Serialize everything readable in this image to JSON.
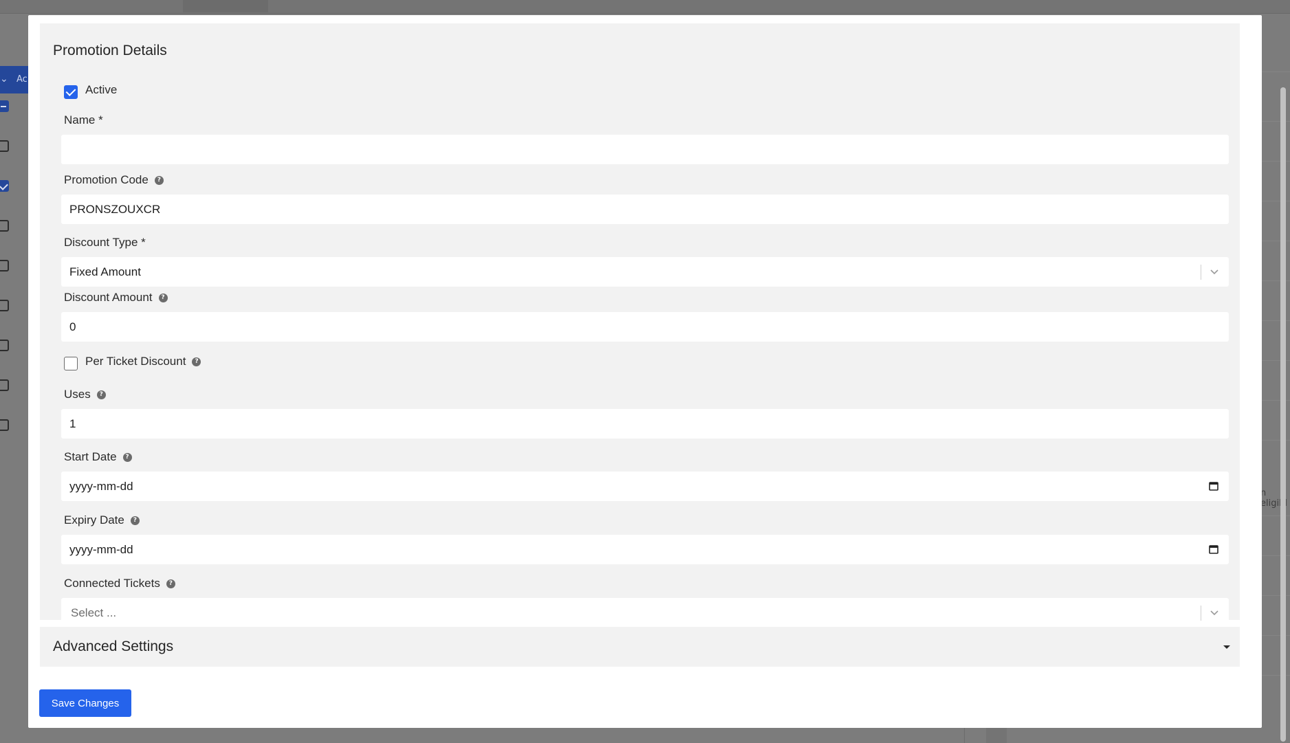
{
  "background": {
    "left_row_label": "Ac",
    "right_peek_text": "n eligibl"
  },
  "modal": {
    "section_title": "Promotion Details",
    "active": {
      "label": "Active",
      "checked": true
    },
    "name": {
      "label": "Name *",
      "value": ""
    },
    "promotion_code": {
      "label": "Promotion Code",
      "value": "PRONSZOUXCR",
      "icon": "help-icon"
    },
    "discount_type": {
      "label": "Discount Type *",
      "value": "Fixed Amount",
      "icon": "chevron-down-icon"
    },
    "discount_amount": {
      "label": "Discount Amount",
      "value": "0",
      "icon": "help-icon"
    },
    "per_ticket_discount": {
      "label": "Per Ticket Discount",
      "checked": false,
      "icon": "help-icon"
    },
    "uses": {
      "label": "Uses",
      "value": "1",
      "icon": "help-icon"
    },
    "start_date": {
      "label": "Start Date",
      "value": "yyyy-mm-dd",
      "icon": "calendar-icon"
    },
    "expiry_date": {
      "label": "Expiry Date",
      "value": "yyyy-mm-dd",
      "icon": "calendar-icon"
    },
    "connected_tickets": {
      "label": "Connected Tickets",
      "placeholder": "Select ...",
      "icon": "chevron-down-icon"
    },
    "advanced_settings": {
      "label": "Advanced Settings",
      "expanded": false
    },
    "save_label": "Save Changes"
  },
  "colors": {
    "primary": "#2563eb",
    "panel_bg": "#f2f2f2",
    "overlay": "#7a7a7a"
  }
}
